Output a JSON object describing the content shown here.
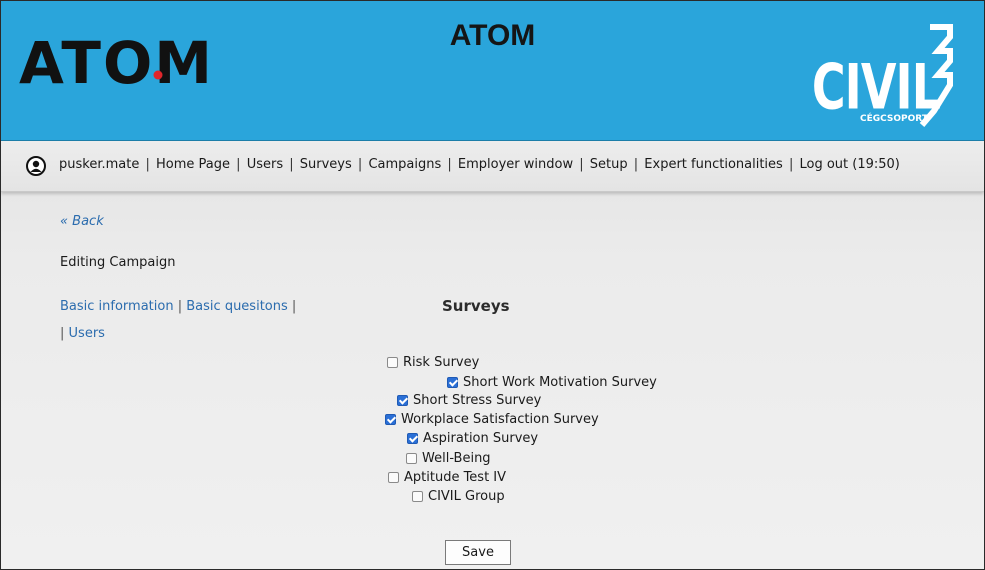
{
  "header": {
    "logo_text": "ATOM",
    "title": "ATOM",
    "brand_logo_text": "CIVIL",
    "brand_logo_subtext": "CÉGCSOPORT",
    "background_color": "#2aa5db"
  },
  "nav": {
    "user_icon": "user-circle-icon",
    "items": [
      {
        "label": "pusker.mate"
      },
      {
        "label": "Home Page"
      },
      {
        "label": "Users"
      },
      {
        "label": "Surveys"
      },
      {
        "label": "Campaigns"
      },
      {
        "label": "Employer window"
      },
      {
        "label": "Setup"
      },
      {
        "label": "Expert functionalities"
      },
      {
        "label": "Log out (19:50)"
      }
    ],
    "separator": "|"
  },
  "content": {
    "back_label": "« Back",
    "subtitle": "Editing Campaign",
    "side_links": {
      "basic_information": "Basic information",
      "basic_questions": "Basic quesitons",
      "users": "Users",
      "separator": "|"
    },
    "section_title": "Surveys",
    "surveys": [
      {
        "label": "Risk Survey",
        "checked": false
      },
      {
        "label": "Short Work Motivation Survey",
        "checked": true
      },
      {
        "label": "Short Stress Survey",
        "checked": true
      },
      {
        "label": "Workplace Satisfaction Survey",
        "checked": true
      },
      {
        "label": "Aspiration Survey",
        "checked": true
      },
      {
        "label": "Well-Being",
        "checked": false
      },
      {
        "label": "Aptitude Test IV",
        "checked": false
      },
      {
        "label": "CIVIL Group",
        "checked": false
      }
    ],
    "save_label": "Save"
  },
  "colors": {
    "link": "#2b6cae",
    "checkbox_checked": "#2a6fd6"
  }
}
